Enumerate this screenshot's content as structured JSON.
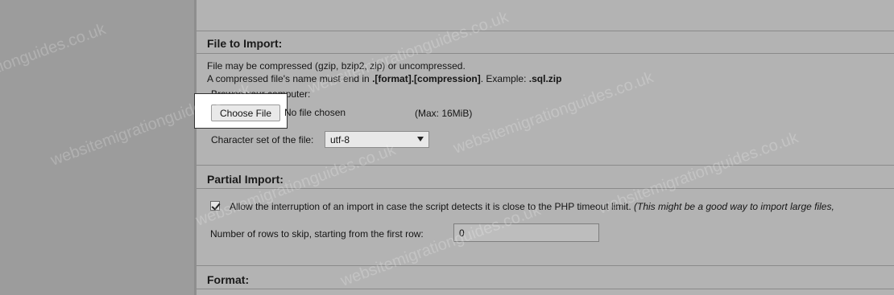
{
  "file_to_import": {
    "title": "File to Import:",
    "line1": "File may be compressed (gzip, bzip2, zip) or uncompressed.",
    "line2_prefix": "A compressed file's name must end in ",
    "line2_format": ".[format].[compression]",
    "line2_mid": ". Example: ",
    "line2_example": ".sql.zip",
    "browse_label": "Browse your computer:",
    "choose_file_label": "Choose File",
    "no_file_text": "No file chosen",
    "max_size": "(Max: 16MiB)",
    "charset_label": "Character set of the file:",
    "charset_value": "utf-8"
  },
  "partial_import": {
    "title": "Partial Import:",
    "allow_interrupt_checked": true,
    "allow_interrupt_label": "Allow the interruption of an import in case the script detects it is close to the PHP timeout limit.",
    "allow_interrupt_note": "(This might be a good way to import large files,",
    "rows_to_skip_label": "Number of rows to skip, starting from the first row:",
    "rows_to_skip_value": "0"
  },
  "format": {
    "title": "Format:"
  },
  "watermark": {
    "text": "websitemigrationguides.co.uk"
  }
}
